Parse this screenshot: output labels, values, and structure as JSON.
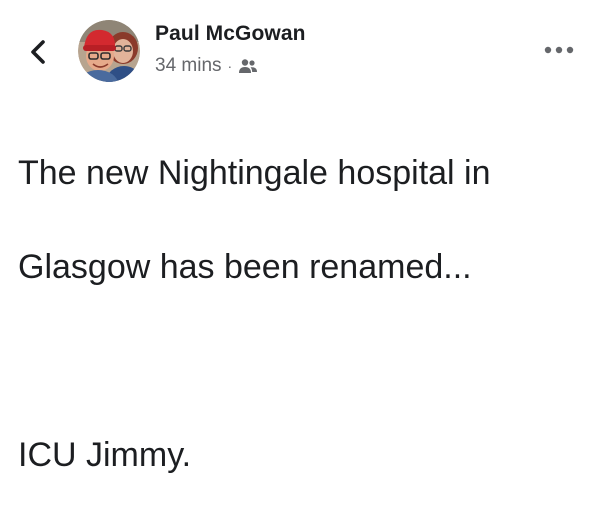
{
  "post": {
    "author": "Paul McGowan",
    "time": "34 mins",
    "separator": "·",
    "audience_icon": "friends-icon",
    "more_icon": "more-options-icon",
    "back_icon": "chevron-left-icon",
    "text_lines": [
      "The new Nightingale hospital in",
      "Glasgow has been renamed...",
      "ICU Jimmy."
    ]
  },
  "colors": {
    "text_primary": "#1c1e21",
    "text_secondary": "#65676b"
  }
}
